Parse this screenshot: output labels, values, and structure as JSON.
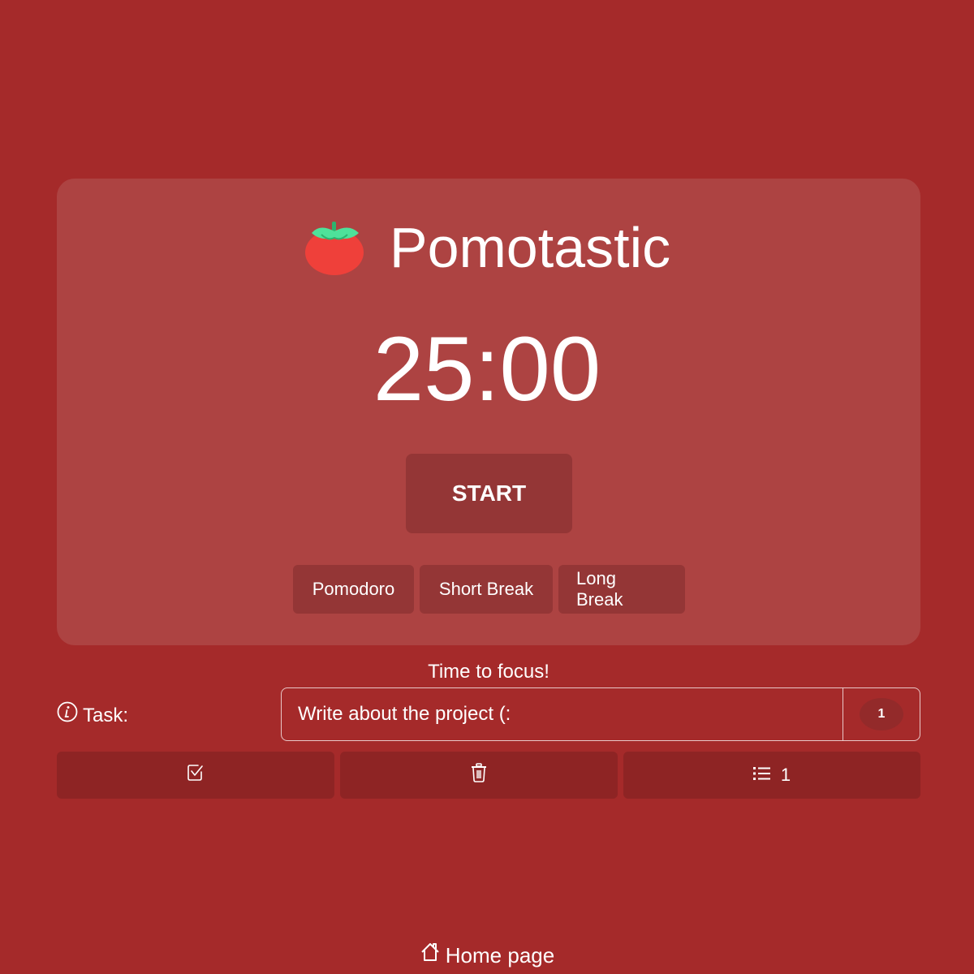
{
  "app": {
    "title": "Pomotastic",
    "logo_icon": "tomato-icon"
  },
  "timer": {
    "display": "25:00",
    "start_label": "START"
  },
  "modes": [
    {
      "label": "Pomodoro"
    },
    {
      "label": "Short Break"
    },
    {
      "label": "Long Break"
    }
  ],
  "status_text": "Time to focus!",
  "task": {
    "label": "Task:",
    "info_icon": "info-icon",
    "value": "Write about the project (:",
    "placeholder": "",
    "count": "1"
  },
  "actions": [
    {
      "icon": "checkbox-check-icon",
      "label": ""
    },
    {
      "icon": "trash-icon",
      "label": ""
    },
    {
      "icon": "list-icon",
      "label": "1"
    }
  ],
  "footer": {
    "home_label": "Home page",
    "home_icon": "house-icon"
  },
  "colors": {
    "background": "#a52a2a",
    "card": "#ad4342",
    "button": "#943636",
    "action_button": "#8e2424"
  }
}
